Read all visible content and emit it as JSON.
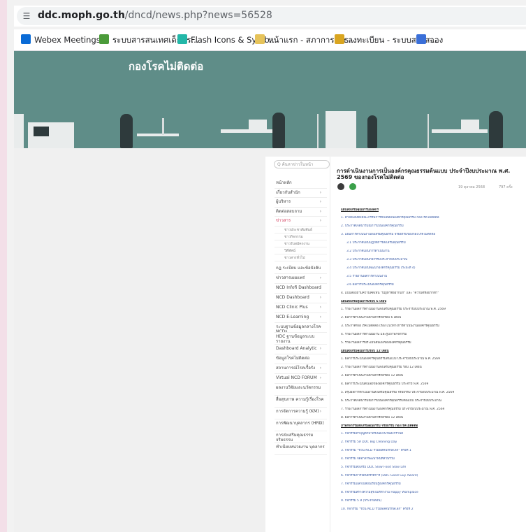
{
  "browser": {
    "url_domain": "ddc.moph.go.th",
    "url_path": "/dncd/news.php?news=56528"
  },
  "bookmarks": [
    {
      "label": "Webex Meetings",
      "color": "#0a6bd6"
    },
    {
      "label": "ระบบสารสนเทศเด็กพร...",
      "color": "#4b9b3a"
    },
    {
      "label": "Flash Icons & Symb...",
      "color": "#23b7a8"
    },
    {
      "label": "หน้าแรก - สภาการสาธ...",
      "color": "#e6c35a"
    },
    {
      "label": "ลงทะเบียน - ระบบสารส...",
      "color": "#d9a520"
    },
    {
      "label": "จอง",
      "color": "#3a6fd8"
    }
  ],
  "banner": {
    "title": "กองโรคไม่ติดต่อ"
  },
  "sidebar": {
    "search_placeholder": "Q  ค้นหาข่าวในหน้า",
    "items": [
      {
        "label": "หน้าหลัก",
        "caret": false
      },
      {
        "label": "เกี่ยวกับสำนัก",
        "caret": true
      },
      {
        "label": "ผู้บริหาร",
        "caret": true
      },
      {
        "label": "ติดต่อสอบถาม",
        "caret": true
      },
      {
        "label": "ข่าวสาร",
        "caret": true,
        "active": true
      }
    ],
    "subitems": [
      "ข่าวประชาสัมพันธ์",
      "ข่าวกิจกรรม",
      "ข่าวรับสมัครงาน",
      "วิดีทัศน์",
      "ข่าวสารทั่วไป"
    ],
    "items2": [
      {
        "label": "กฎ ระเบียบ และข้อบังคับ",
        "caret": false
      },
      {
        "label": "ข่าวสารเผยแพร่",
        "caret": true
      },
      {
        "label": "NCD Infofi Dashboard",
        "caret": true
      },
      {
        "label": "NCD Dashboard",
        "caret": true
      },
      {
        "label": "NCD Clinic Plus",
        "caret": true
      },
      {
        "label": "NCD E-Learning",
        "caret": true
      },
      {
        "label": "ระบบฐานข้อมูลกลางโรค NCDs",
        "caret": true
      },
      {
        "label": "HDC ฐานข้อมูลระบบรายงาน",
        "caret": false
      },
      {
        "label": "Dashboard Analytic",
        "caret": true
      },
      {
        "label": "ข้อมูลโรคไม่ติดต่อ",
        "caret": false
      },
      {
        "label": "สถานการณ์โรคเรื้อรัง",
        "caret": true
      },
      {
        "label": "Virtual NCD FORUM",
        "caret": true
      },
      {
        "label": "ผลงานวิจัยและนวัตกรรม",
        "caret": false
      },
      {
        "label": "สื่อสุขภาพ ความรู้เรื่องโรค",
        "caret": false
      },
      {
        "label": "การจัดการความรู้ (KM)",
        "caret": true
      },
      {
        "label": "การพัฒนาบุคลากร (HRD)",
        "caret": true
      },
      {
        "label": "การส่งเสริมคุณธรรม จริยธรรม",
        "caret": false
      },
      {
        "label": "ทำเนียบหน่วยงาน บุคลากร",
        "caret": false
      }
    ]
  },
  "article": {
    "title": "การดำเนินงานการเป็นองค์กรคุณธรรมต้นแบบ ประจำปีงบประมาณ พ.ศ. 2569 ของกองโรคไม่ติดต่อ",
    "date": "19 ตุลาคม 2568",
    "views": "797 ครั้ง",
    "lines": [
      {
        "t": "แผนส่งเสริมคุณธรรมองค์กร",
        "k": "head"
      },
      {
        "t": "1. คำสั่งแต่งตั้งคณะกรรมการขับเคลื่อนองค์กรคุณธรรม กองโรคไม่ติดต่อ",
        "k": "link"
      },
      {
        "t": "2. ประกาศเจตนารมณ์การเป็นองค์กรคุณธรรม",
        "k": "link"
      },
      {
        "t": "3. แผนการดำเนินงานส่งเสริมคุณธรรม จริยธรรมของกองโรคไม่ติดต่อ",
        "k": "link"
      },
      {
        "t": "3.1 ประกาศแผนปฏิบัติการส่งเสริมคุณธรรม",
        "k": "ind"
      },
      {
        "t": "3.2 ประกาศแผนการดำเนินงาน",
        "k": "ind"
      },
      {
        "t": "3.3 ประกาศแผนกิจกรรมประจำปีงบประมาณ",
        "k": "ind"
      },
      {
        "t": "3.4 ประกาศแผนพัฒนาองค์กรคุณธรรม (ระยะที่ 4)",
        "k": "ind"
      },
      {
        "t": "3.5 รายงานผลการดำเนินงาน",
        "k": "ind"
      },
      {
        "t": "3.6 ผลการประเมินองค์กรคุณธรรม",
        "k": "ind"
      },
      {
        "t": "4. แบบสอบถามความคิดเห็น \"ปัญหาที่อยากแก้\" และ \"ความดีที่อยากทำ\"",
        "k": "txt"
      },
      {
        "t": "แผนส่งเสริมคุณธรรมรอบ 6 เดือน",
        "k": "head"
      },
      {
        "t": "1. รายงานผลการดำเนินงานส่งเสริมคุณธรรม ประจำปีงบประมาณ พ.ศ. 2569",
        "k": "txt"
      },
      {
        "t": "2. ผลการดำเนินงานตามตัวชี้วัดรอบ 6 เดือน",
        "k": "txt"
      },
      {
        "t": "3. ประกาศกองโรคไม่ติดต่อ เรื่อง แนวทางการดำเนินงานองค์กรคุณธรรม",
        "k": "txt"
      },
      {
        "t": "4. รายงานผลการดำเนินงาน และรูปภาพกิจกรรม",
        "k": "txt"
      },
      {
        "t": "5. รายงานผลการประเมินตนเองขององค์กรคุณธรรม",
        "k": "txt"
      },
      {
        "t": "แผนส่งเสริมคุณธรรมรอบ 12 เดือน",
        "k": "head"
      },
      {
        "t": "1. ผลการประเมินองค์กรคุณธรรมต้นแบบ ประจำปีงบประมาณ พ.ศ. 2569",
        "k": "txt"
      },
      {
        "t": "2. รายงานผลการดำเนินงานส่งเสริมคุณธรรม รอบ 12 เดือน",
        "k": "txt"
      },
      {
        "t": "3. ผลการดำเนินงานตามตัวชี้วัดรอบ 12 เดือน",
        "k": "txt"
      },
      {
        "t": "4. ผลการประเมินตนเองขององค์กรคุณธรรม ประจำปี พ.ศ. 2569",
        "k": "txt"
      },
      {
        "t": "5. สรุปผลการดำเนินงานส่งเสริมคุณธรรม จริยธรรม ประจำปีงบประมาณ พ.ศ. 2569",
        "k": "txt"
      },
      {
        "t": "6. ประกาศเจตนารมณ์การเป็นองค์กรคุณธรรมต้นแบบ ประจำปีงบประมาณ",
        "k": "txt"
      },
      {
        "t": "7. รายงานผลการดำเนินงานองค์กรคุณธรรม ประจำปีงบประมาณ พ.ศ. 2569",
        "k": "txt"
      },
      {
        "t": "8. ผลการดำเนินงานตามตัวชี้วัดรอบ 12 เดือน",
        "k": "txt"
      },
      {
        "t": "ภาพกิจกรรมส่งเสริมคุณธรรม จริยธรรม กองโรคไม่ติดต่อ",
        "k": "head"
      },
      {
        "t": "1. กิจกรรมทำบุญตักบาตรเนื่องในวันสงกรานต์",
        "k": "link"
      },
      {
        "t": "2. กิจกรรม 5ส DDC Big Cleaning Day",
        "k": "link"
      },
      {
        "t": "3. กิจกรรม \"ชวน NCD รวมพลคนรักษ์โลก\" ครั้งที่ 1",
        "k": "link"
      },
      {
        "t": "4. กิจกรรม จิตอาสาพัฒนาพื้นที่ส่วนรวม",
        "k": "link"
      },
      {
        "t": "5. กิจกรรมส่งเสริม DDC Slow Food Slow Life",
        "k": "link"
      },
      {
        "t": "6. กิจกรรมการจัดนิทรรศการ (DDC Good Guy Award)",
        "k": "link"
      },
      {
        "t": "7. กิจกรรมแลกเปลี่ยนเรียนรู้องค์กรคุณธรรม",
        "k": "link"
      },
      {
        "t": "8. กิจกรรมสร้างความสุขในที่ทำงาน Happy Workplace",
        "k": "link"
      },
      {
        "t": "9. กิจกรรม 5 ส (ประจำเดือน)",
        "k": "link"
      },
      {
        "t": "10. กิจกรรม \"ชวน NCD รวมพลคนรักษ์โลก\" ครั้งที่ 2",
        "k": "link"
      }
    ]
  }
}
